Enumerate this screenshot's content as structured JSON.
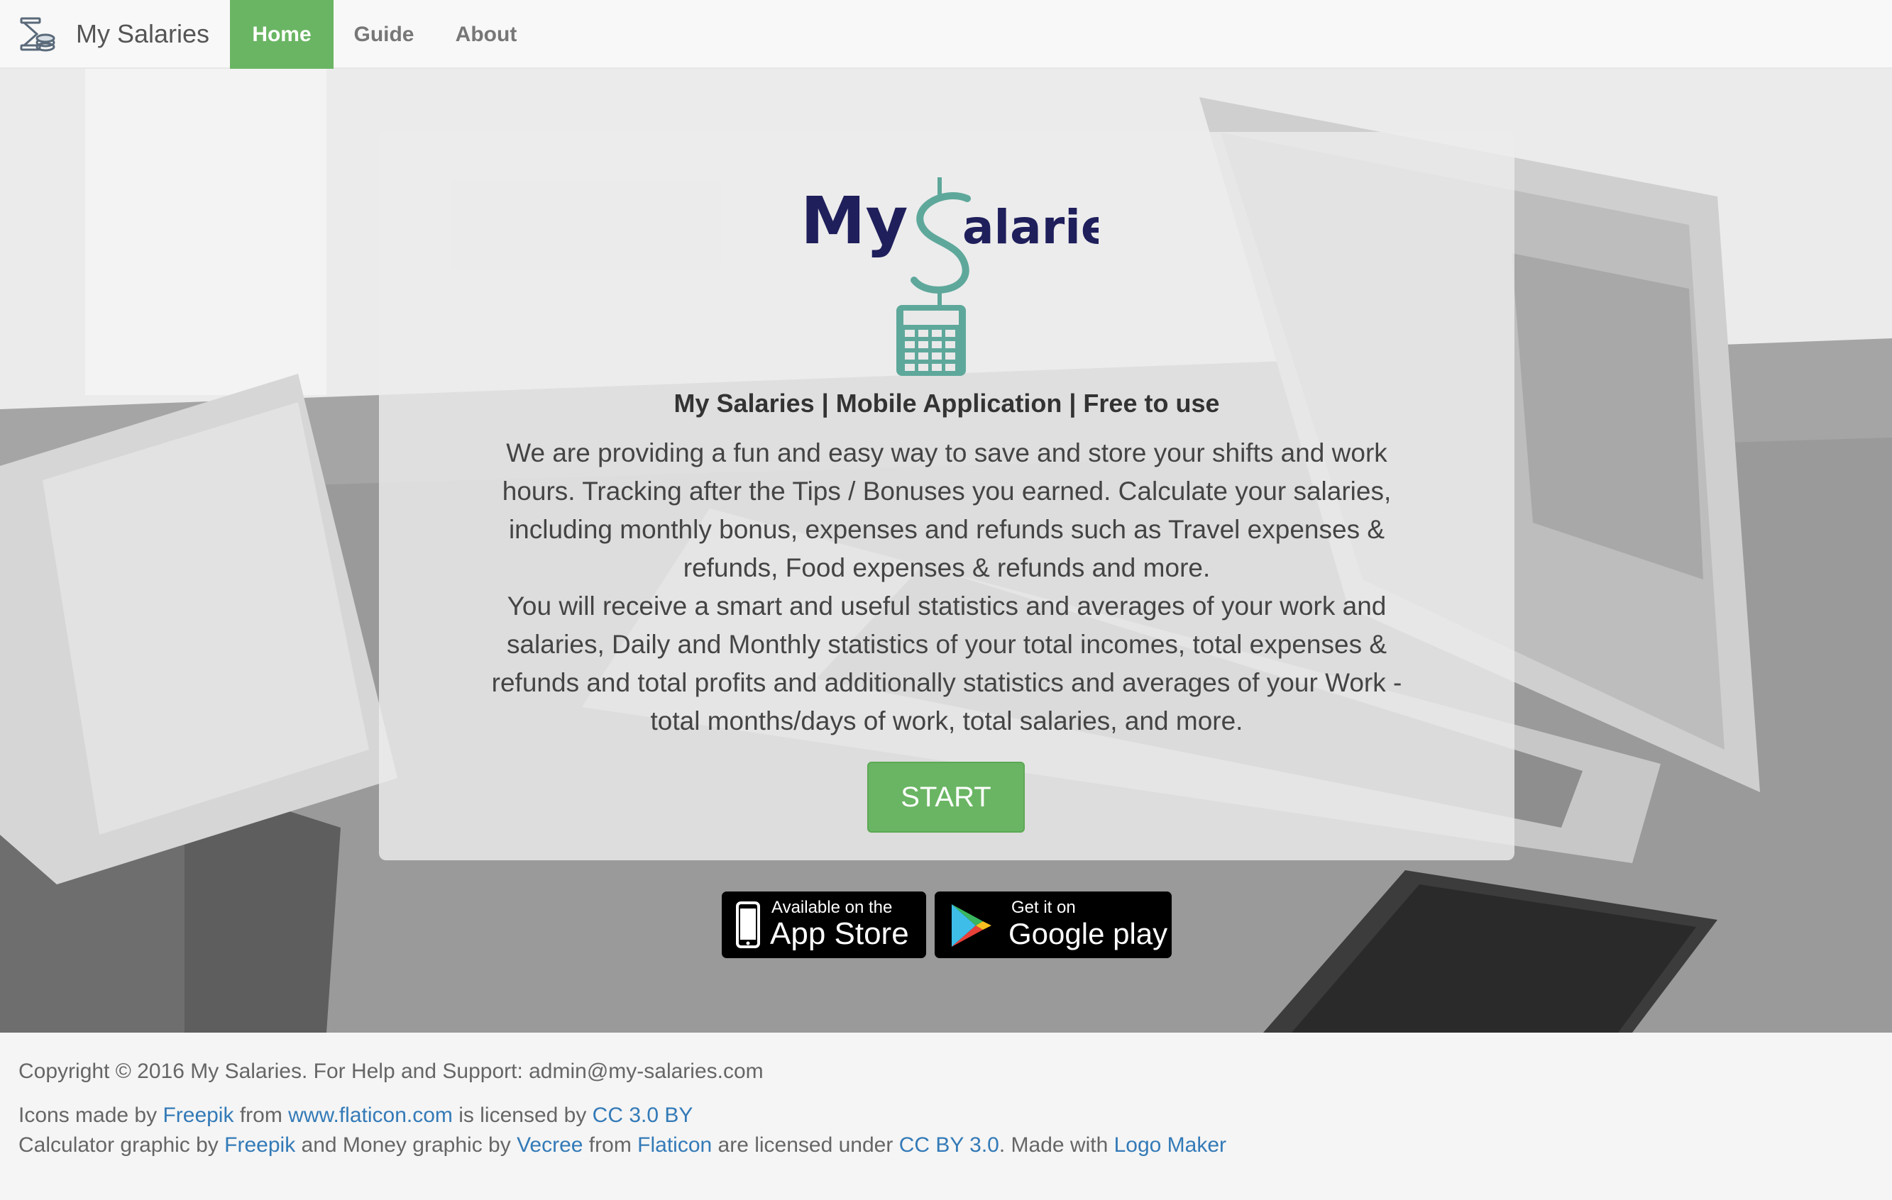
{
  "navbar": {
    "brand": "My Salaries",
    "items": [
      {
        "label": "Home",
        "active": true
      },
      {
        "label": "Guide",
        "active": false
      },
      {
        "label": "About",
        "active": false
      }
    ]
  },
  "hero": {
    "logo_text_my": "My",
    "logo_text_alaries": "alaries",
    "tagline": "My Salaries | Mobile Application | Free to use",
    "paragraph1": "We are providing a fun and easy way to save and store your shifts and work hours. Tracking after the Tips / Bonuses you earned. Calculate your salaries, including monthly bonus, expenses and refunds such as Travel expenses & refunds, Food expenses & refunds and more.",
    "paragraph2": "You will receive a smart and useful statistics and averages of your work and salaries, Daily and Monthly statistics of your total incomes, total expenses & refunds and total profits and additionally statistics and averages of your Work - total months/days of work, total salaries, and more.",
    "start_label": "START",
    "app_store": {
      "small": "Available on the",
      "big": "App Store"
    },
    "google_play": {
      "small": "Get it on",
      "big_google": "Google",
      "big_play": "play"
    }
  },
  "footer": {
    "copyright": "Copyright © 2016 My Salaries. For Help and Support: admin@my-salaries.com",
    "line2": {
      "t1": "Icons made by ",
      "l1": "Freepik",
      "t2": " from ",
      "l2": "www.flaticon.com",
      "t3": " is licensed by ",
      "l3": "CC 3.0 BY"
    },
    "line3": {
      "t1": "Calculator graphic by ",
      "l1": "Freepik",
      "t2": " and Money graphic by ",
      "l2": "Vecree",
      "t3": " from ",
      "l3": "Flaticon",
      "t4": " are licensed under ",
      "l4": "CC BY 3.0",
      "t5": ". Made with ",
      "l5": "Logo Maker"
    }
  },
  "colors": {
    "accent_green": "#6ab563",
    "logo_navy": "#1f1f5c",
    "logo_teal": "#5ea89b",
    "link_blue": "#337ab7"
  }
}
